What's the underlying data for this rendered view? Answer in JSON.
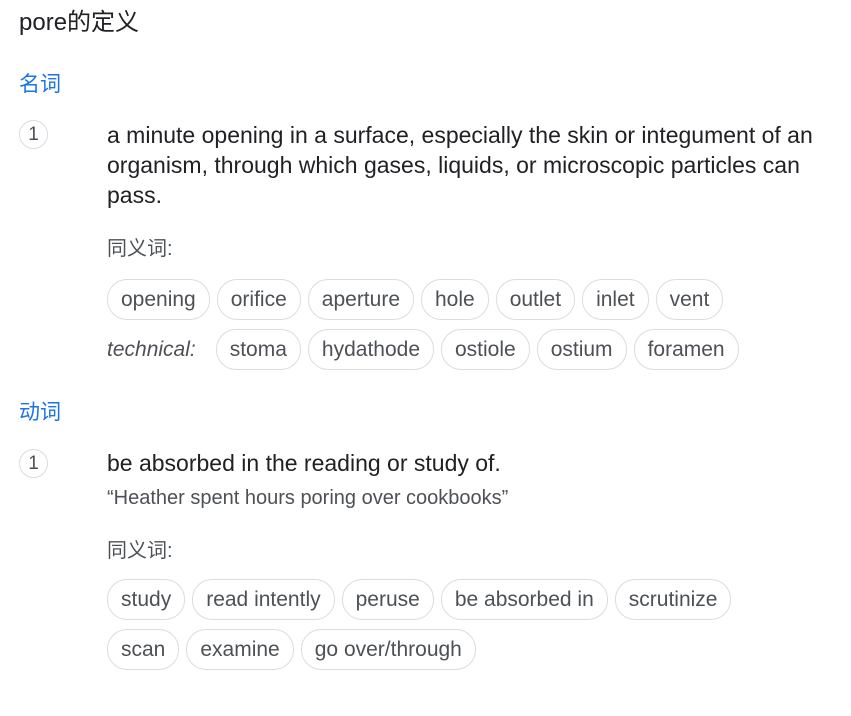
{
  "title": "pore的定义",
  "noun": {
    "pos_label": "名词",
    "sense_number": "1",
    "definition": "a minute opening in a surface, especially the skin or integument of an organism, through which gases, liquids, or microscopic particles can pass.",
    "synonyms_label": "同义词:",
    "synonyms": [
      "opening",
      "orifice",
      "aperture",
      "hole",
      "outlet",
      "inlet",
      "vent"
    ],
    "technical_label": "technical:",
    "technical_synonyms": [
      "stoma",
      "hydathode",
      "ostiole",
      "ostium",
      "foramen"
    ]
  },
  "verb": {
    "pos_label": "动词",
    "sense_number": "1",
    "definition": "be absorbed in the reading or study of.",
    "example": "“Heather spent hours poring over cookbooks”",
    "synonyms_label": "同义词:",
    "synonyms_row1": [
      "study",
      "read intently",
      "peruse",
      "be absorbed in",
      "scrutinize"
    ],
    "synonyms_row2": [
      "scan",
      "examine",
      "go over/through"
    ]
  }
}
